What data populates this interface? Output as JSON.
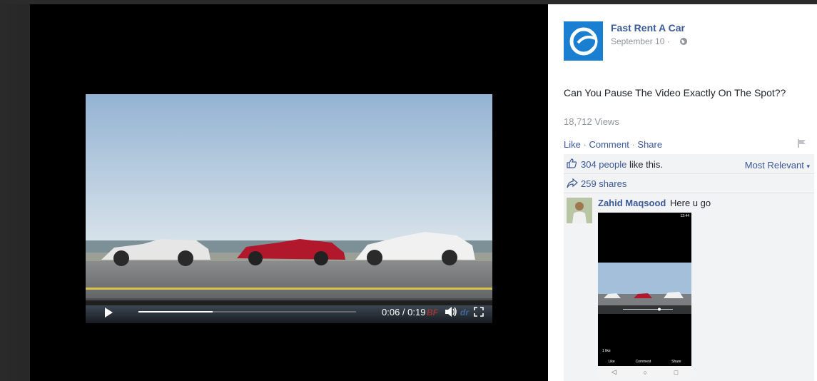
{
  "video": {
    "time_display": "0:06 / 0:19",
    "progress": 0.34,
    "watermark_left": "BF",
    "watermark_right": "dr"
  },
  "post": {
    "page_name": "Fast Rent A Car",
    "date": "September 10 ·",
    "text": "Can You Pause The Video Exactly On The Spot??",
    "views": "18,712 Views",
    "actions": {
      "like": "Like",
      "comment": "Comment",
      "share": "Share",
      "sep": "·"
    },
    "likes": {
      "count_link": "304 people",
      "suffix": "like this."
    },
    "sort_label": "Most Relevant",
    "shares": "259 shares",
    "brand_color": "#3b5998",
    "logo_color": "#1a7fd0"
  },
  "comment": {
    "author": "Zahid Maqsood",
    "text": "Here u go",
    "screenshot": {
      "status": "12:44",
      "likes": "1 like",
      "like": "Like",
      "comment": "Comment",
      "share": "Share",
      "nav": [
        "◁",
        "○",
        "□"
      ]
    }
  }
}
